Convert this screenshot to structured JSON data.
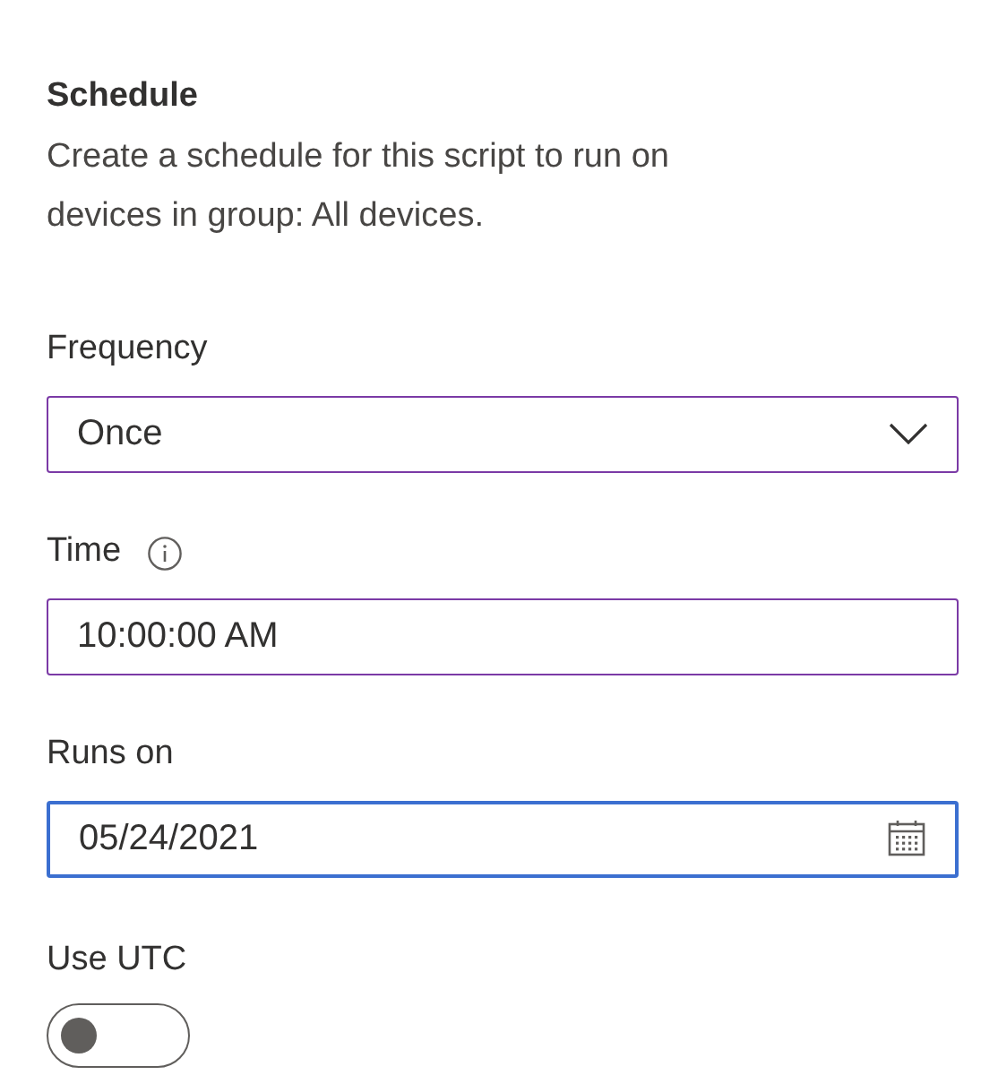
{
  "section": {
    "title": "Schedule",
    "description": "Create a schedule for this script to run on devices in group: All devices."
  },
  "fields": [
    {
      "kind": "dropdown",
      "label": "Frequency",
      "value": "Once",
      "focused": false
    },
    {
      "kind": "text",
      "label": "Time",
      "info": true,
      "value": "10:00:00 AM",
      "focused": false
    },
    {
      "kind": "date",
      "label": "Runs on",
      "value": "05/24/2021",
      "focused": true
    }
  ],
  "toggle": {
    "label": "Use UTC",
    "on": false
  }
}
